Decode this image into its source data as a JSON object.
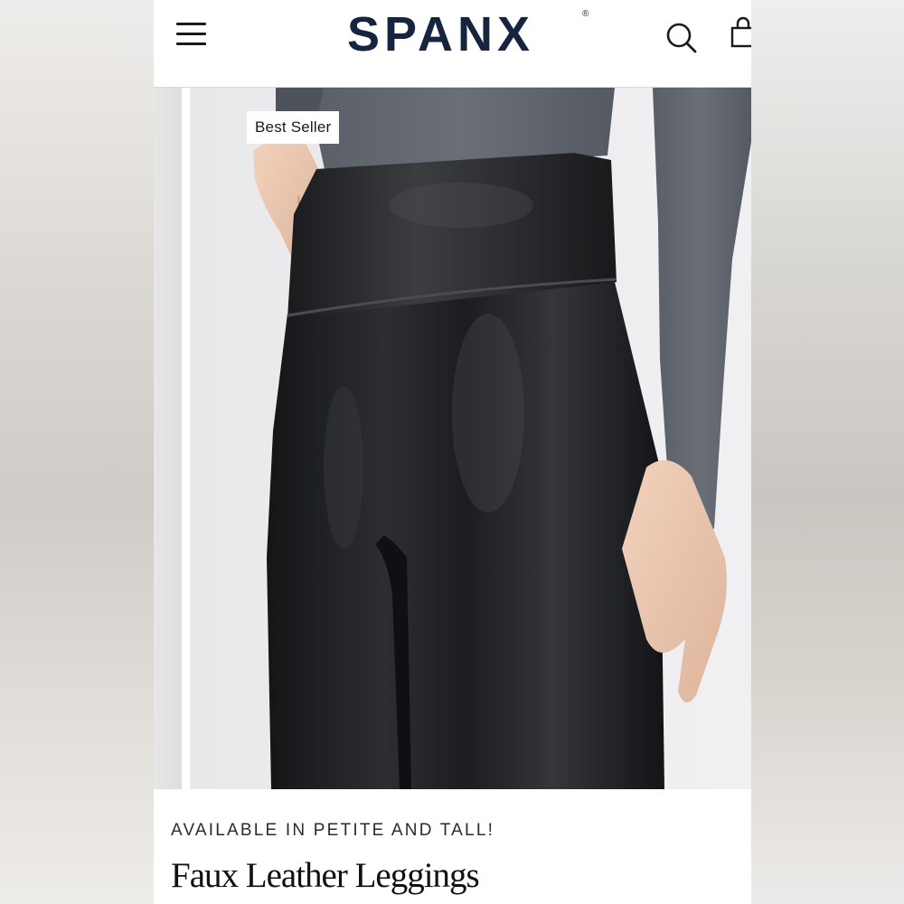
{
  "header": {
    "brand": "SPANX",
    "brand_mark": "®",
    "menu_icon": "hamburger-menu-icon",
    "search_icon": "search-icon",
    "cart_icon": "shopping-bag-icon"
  },
  "carousel": {
    "badge": "Best Seller"
  },
  "product": {
    "availability": "AVAILABLE IN PETITE AND TALL!",
    "title": "Faux Leather Leggings"
  },
  "colors": {
    "brand_navy": "#16243f",
    "legging_black": "#1c1d1f",
    "top_gray": "#5b606a"
  }
}
